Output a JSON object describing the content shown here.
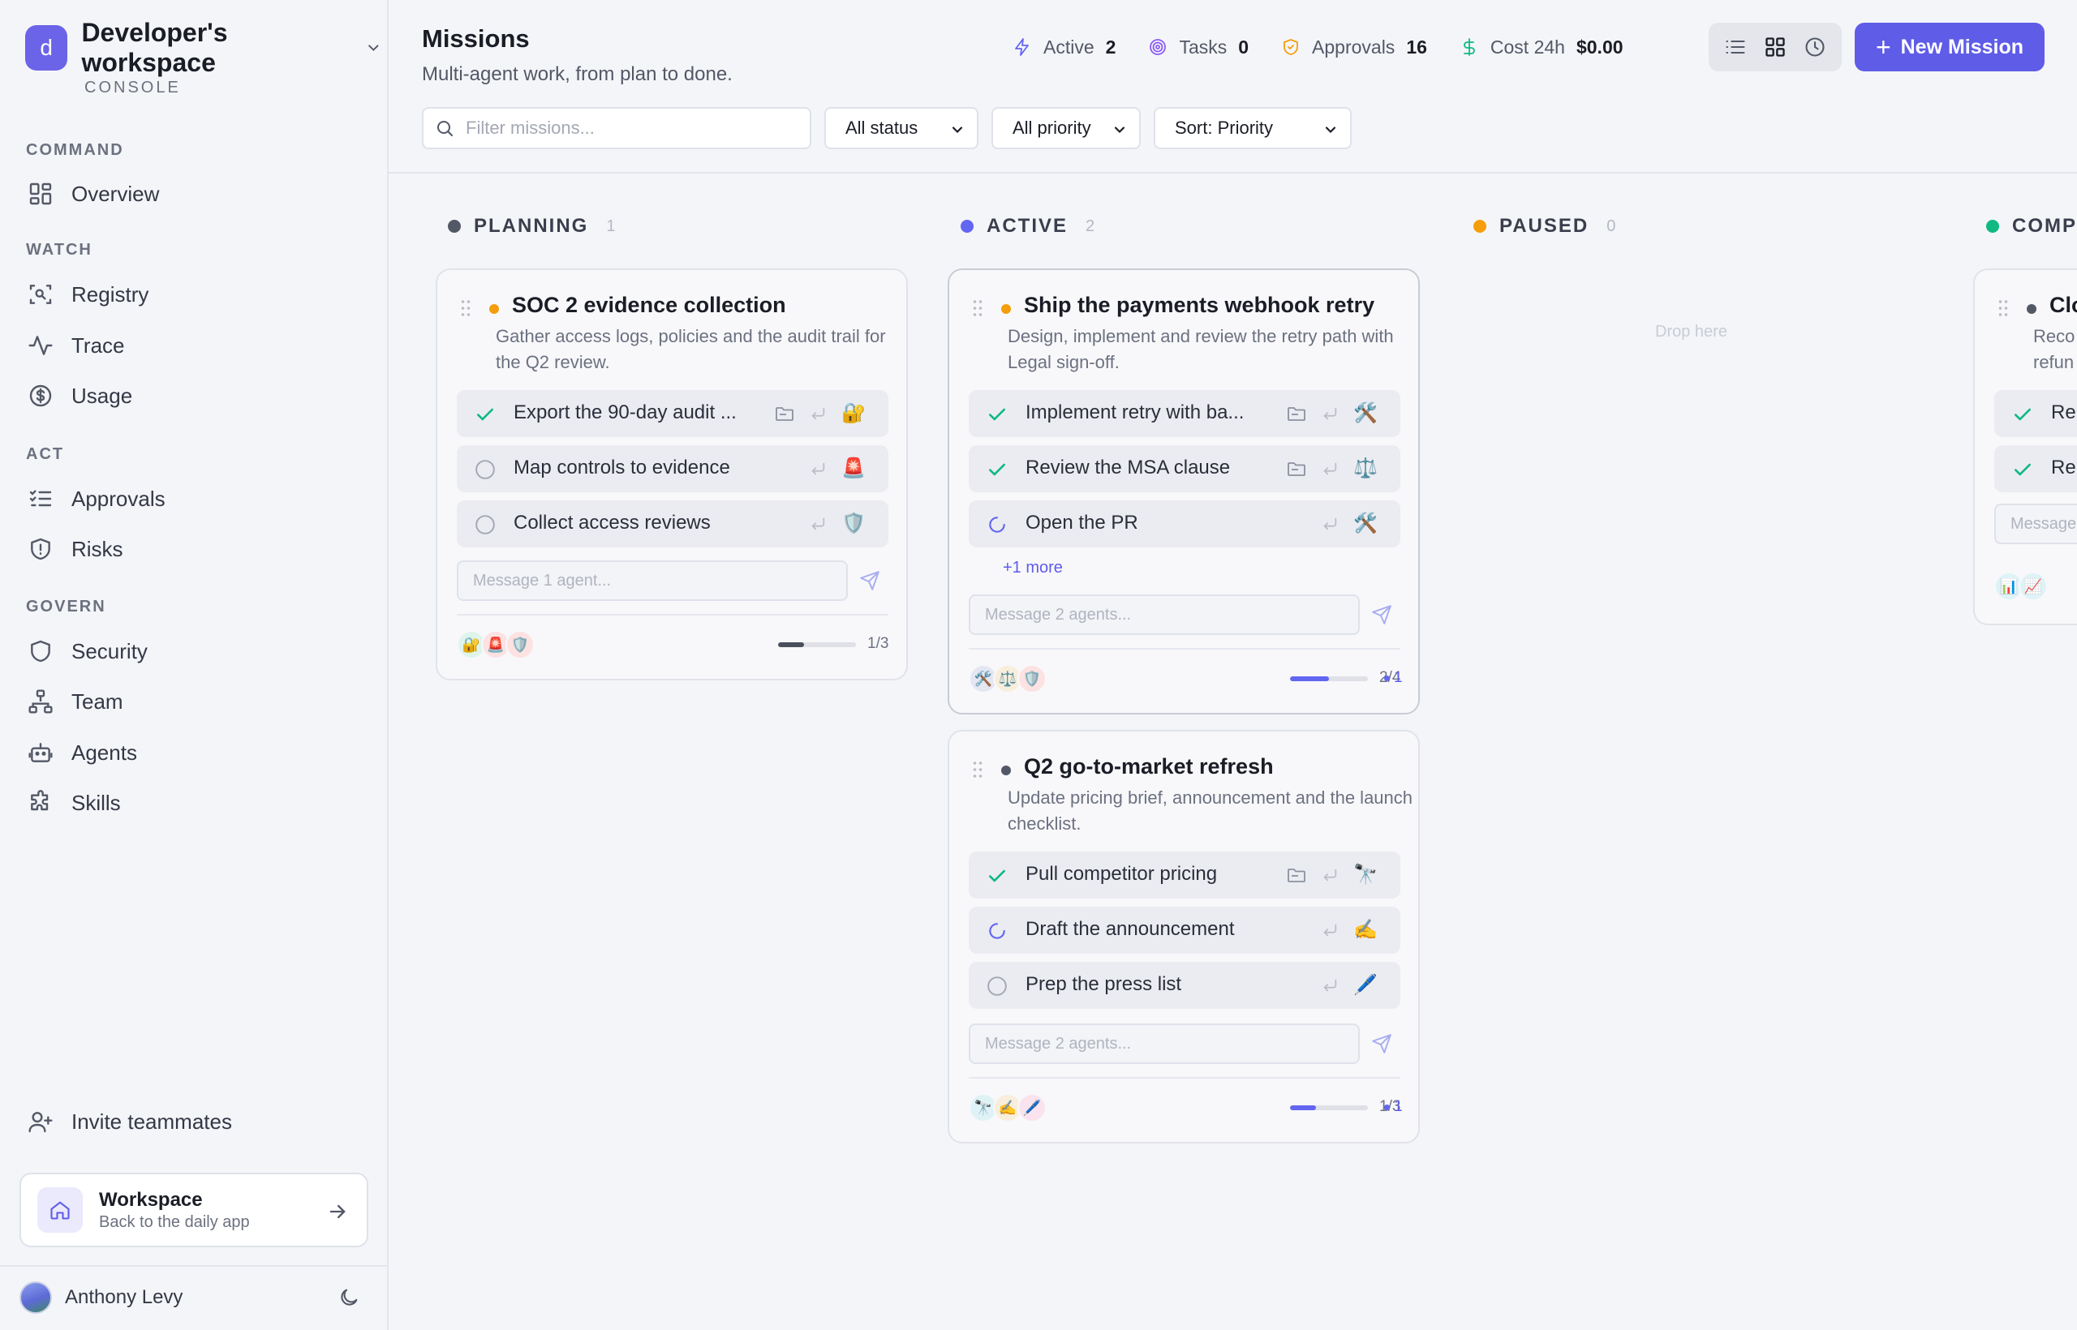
{
  "sidebar": {
    "workspace_logo": "d",
    "workspace_name": "Developer's workspace",
    "workspace_sub": "CONSOLE",
    "sections": {
      "command": "COMMAND",
      "watch": "WATCH",
      "act": "ACT",
      "govern": "GOVERN"
    },
    "items": {
      "overview": "Overview",
      "registry": "Registry",
      "trace": "Trace",
      "usage": "Usage",
      "approvals": "Approvals",
      "risks": "Risks",
      "security": "Security",
      "team": "Team",
      "agents": "Agents",
      "skills": "Skills"
    },
    "invite": "Invite teammates",
    "workspace_card": {
      "title": "Workspace",
      "subtitle": "Back to the daily app"
    },
    "user_name": "Anthony Levy"
  },
  "header": {
    "title": "Missions",
    "subtitle": "Multi-agent work, from plan to done.",
    "stats": {
      "active_label": "Active",
      "active_value": "2",
      "tasks_label": "Tasks",
      "tasks_value": "0",
      "approvals_label": "Approvals",
      "approvals_value": "16",
      "cost_label": "Cost 24h",
      "cost_value": "$0.00"
    },
    "new_mission": "New Mission",
    "filter_placeholder": "Filter missions...",
    "status_select": "All status",
    "priority_select": "All priority",
    "sort_select": "Sort: Priority"
  },
  "columns": {
    "planning": {
      "label": "PLANNING",
      "count": "1",
      "color": "#525866"
    },
    "active": {
      "label": "ACTIVE",
      "count": "2",
      "color": "#6366f1"
    },
    "paused": {
      "label": "PAUSED",
      "count": "0",
      "color": "#f59e0b",
      "empty_text": "Drop here"
    },
    "completed": {
      "label": "COMP",
      "color": "#10b981"
    }
  },
  "cards": {
    "soc2": {
      "title": "SOC 2 evidence collection",
      "desc": "Gather access logs, policies and the audit trail for the Q2 review.",
      "priority_color": "#f59e0b",
      "tasks": [
        {
          "label": "Export the 90-day audit ...",
          "emoji": "🔐"
        },
        {
          "label": "Map controls to evidence",
          "emoji": "🚨"
        },
        {
          "label": "Collect access reviews",
          "emoji": "🛡️"
        }
      ],
      "message_placeholder": "Message 1 agent...",
      "agents": [
        "🔐",
        "🚨",
        "🛡️"
      ],
      "progress": 0.33,
      "progress_text": "1/3"
    },
    "payments": {
      "title": "Ship the payments webhook retry",
      "desc": "Design, implement and review the retry path with Legal sign-off.",
      "priority_color": "#f59e0b",
      "tasks": [
        {
          "label": "Implement retry with ba...",
          "emoji": "🛠️"
        },
        {
          "label": "Review the MSA clause",
          "emoji": "⚖️"
        },
        {
          "label": "Open the PR",
          "emoji": "🛠️"
        }
      ],
      "more": "+1 more",
      "message_placeholder": "Message 2 agents...",
      "agents": [
        "🛠️",
        "⚖️",
        "🛡️"
      ],
      "progress": 0.5,
      "progress_text": "2/4",
      "badge": "1"
    },
    "gtm": {
      "title": "Q2 go-to-market refresh",
      "desc": "Update pricing brief, announcement and the launch checklist.",
      "priority_color": "#525866",
      "tasks": [
        {
          "label": "Pull competitor pricing",
          "emoji": "🔭"
        },
        {
          "label": "Draft the announcement",
          "emoji": "✍️"
        },
        {
          "label": "Prep the press list",
          "emoji": "🖊️"
        }
      ],
      "message_placeholder": "Message 2 agents...",
      "agents": [
        "🔭",
        "✍️",
        "🖊️"
      ],
      "progress": 0.33,
      "progress_text": "1/3",
      "badge": "1"
    },
    "partial": {
      "title": "Clo",
      "desc_line1": "Reco",
      "desc_line2": "refun",
      "task1": "Re",
      "task2": "Re",
      "message_placeholder": "Message",
      "agents": [
        "📊",
        "📈"
      ]
    }
  }
}
